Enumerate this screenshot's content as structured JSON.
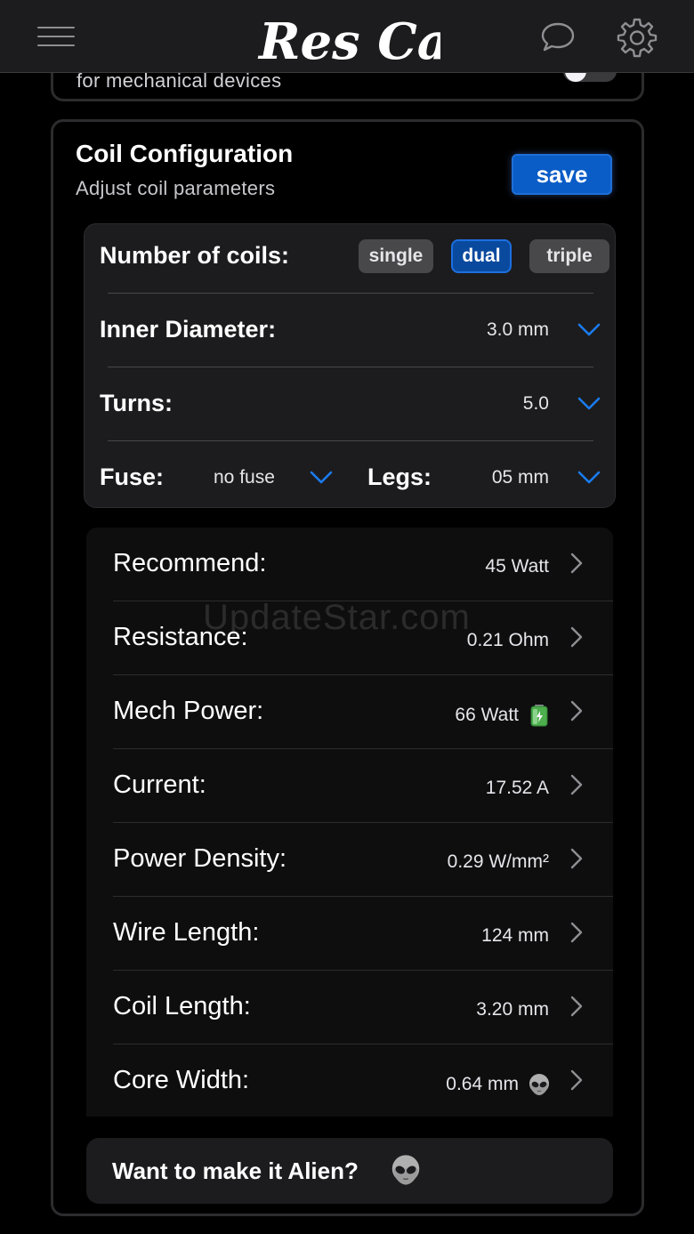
{
  "header": {
    "logo_text": "Res Calc",
    "menu_icon": "hamburger-menu-icon",
    "chat_icon": "speech-bubble-icon",
    "settings_icon": "gear-icon"
  },
  "top_card": {
    "text": "for mechanical devices"
  },
  "coil_configuration": {
    "title": "Coil Configuration",
    "subtitle": "Adjust coil parameters",
    "save_label": "save",
    "number_of_coils": {
      "label": "Number of coils:",
      "options": [
        "single",
        "dual",
        "triple"
      ],
      "selected": "dual"
    },
    "inner_diameter": {
      "label": "Inner Diameter:",
      "value": "3.0 mm"
    },
    "turns": {
      "label": "Turns:",
      "value": "5.0"
    },
    "fuse": {
      "label": "Fuse:",
      "value": "no fuse"
    },
    "legs": {
      "label": "Legs:",
      "value": "05 mm"
    }
  },
  "results": [
    {
      "label": "Recommend:",
      "value": "45 Watt",
      "badge": ""
    },
    {
      "label": "Resistance:",
      "value": "0.21 Ohm",
      "badge": ""
    },
    {
      "label": "Mech Power:",
      "value": "66 Watt",
      "badge": "battery-icon"
    },
    {
      "label": "Current:",
      "value": "17.52 A",
      "badge": ""
    },
    {
      "label": "Power Density:",
      "value": "0.29 W/mm²",
      "badge": ""
    },
    {
      "label": "Wire Length:",
      "value": "124 mm",
      "badge": ""
    },
    {
      "label": "Coil Length:",
      "value": "3.20 mm",
      "badge": ""
    },
    {
      "label": "Core Width:",
      "value": "0.64 mm",
      "badge": "alien-icon"
    }
  ],
  "alien_banner": {
    "text": "Want to make it Alien?",
    "icon": "alien-icon"
  },
  "watermark": "UpdateStar.com",
  "colors": {
    "accent": "#0a5cc7",
    "chevron": "#1a7cf0",
    "panel": "#1c1c1e",
    "background": "#000000"
  }
}
